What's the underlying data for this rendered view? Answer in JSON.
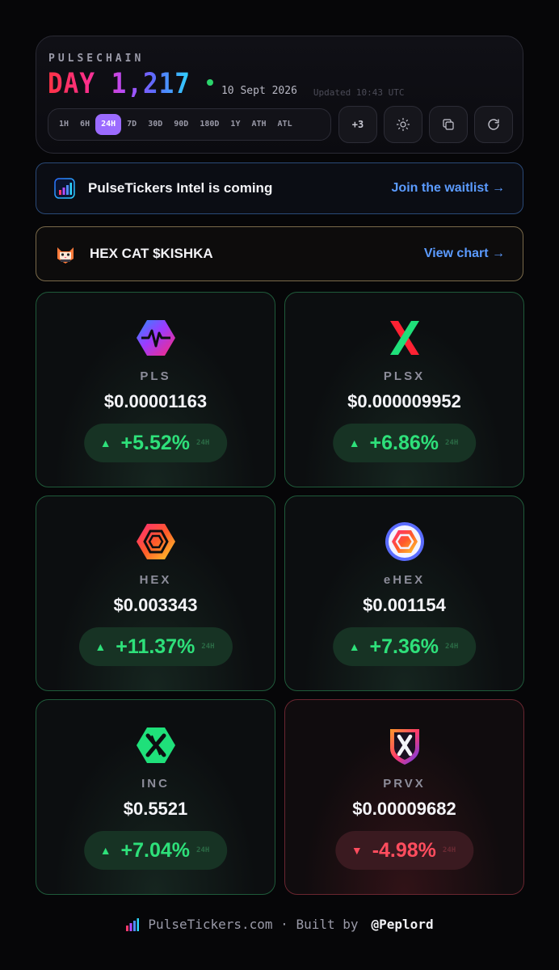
{
  "header": {
    "chain": "PULSECHAIN",
    "day_label": "DAY 1,217",
    "date": "10 Sept 2026",
    "updated": "Updated 10:43 UTC",
    "timeframes": [
      "1H",
      "6H",
      "24H",
      "7D",
      "30D",
      "90D",
      "180D",
      "1Y",
      "ATH",
      "ATL"
    ],
    "active_timeframe": "24H",
    "more_label": "+3"
  },
  "banners": {
    "intel": {
      "title": "PulseTickers Intel is coming",
      "link": "Join the waitlist →"
    },
    "cat": {
      "title": "HEX CAT $KISHKA",
      "link": "View chart →"
    }
  },
  "tokens": [
    {
      "symbol": "PLS",
      "price": "$0.00001163",
      "change": "+5.52%",
      "period": "24H",
      "direction": "up"
    },
    {
      "symbol": "PLSX",
      "price": "$0.000009952",
      "change": "+6.86%",
      "period": "24H",
      "direction": "up"
    },
    {
      "symbol": "HEX",
      "price": "$0.003343",
      "change": "+11.37%",
      "period": "24H",
      "direction": "up"
    },
    {
      "symbol": "eHEX",
      "price": "$0.001154",
      "change": "+7.36%",
      "period": "24H",
      "direction": "up"
    },
    {
      "symbol": "INC",
      "price": "$0.5521",
      "change": "+7.04%",
      "period": "24H",
      "direction": "up"
    },
    {
      "symbol": "PRVX",
      "price": "$0.00009682",
      "change": "-4.98%",
      "period": "24H",
      "direction": "down"
    }
  ],
  "arrows": {
    "up": "▲",
    "down": "▼"
  },
  "footer": {
    "site": "PulseTickers.com · Built by",
    "handle": "@Peplord"
  },
  "colors": {
    "up": "#2ee07a",
    "down": "#ff4d5e",
    "accent": "#9b6bff",
    "link": "#5b9bff"
  }
}
